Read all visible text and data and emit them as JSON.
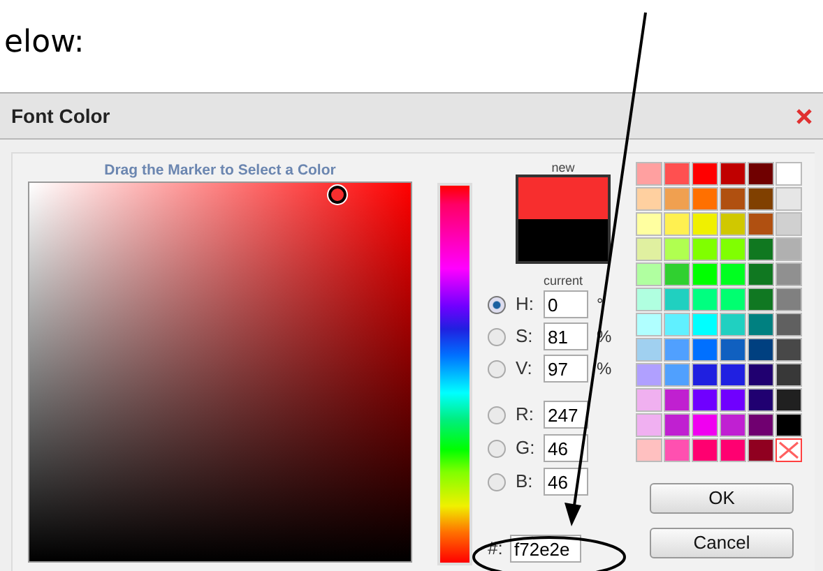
{
  "document_text": "elow:",
  "dialog": {
    "title": "Font Color",
    "heading": "Drag the Marker to Select a Color",
    "preview": {
      "new_label": "new",
      "current_label": "current"
    },
    "hsv_fields": [
      {
        "label": "H:",
        "value": "0",
        "unit": "°",
        "selected": true
      },
      {
        "label": "S:",
        "value": "81",
        "unit": "%",
        "selected": false
      },
      {
        "label": "V:",
        "value": "97",
        "unit": "%",
        "selected": false
      }
    ],
    "rgb_fields": [
      {
        "label": "R:",
        "value": "247",
        "selected": false
      },
      {
        "label": "G:",
        "value": "46",
        "selected": false
      },
      {
        "label": "B:",
        "value": "46",
        "selected": false
      }
    ],
    "hex_field": {
      "label": "#:",
      "value": "f72e2e"
    },
    "swatches": [
      {
        "kind": "color",
        "color": "#ffa0a0"
      },
      {
        "kind": "color",
        "color": "#ff5050"
      },
      {
        "kind": "color",
        "color": "#ff0000"
      },
      {
        "kind": "color",
        "color": "#c00000"
      },
      {
        "kind": "color",
        "color": "#700000"
      },
      {
        "kind": "color",
        "color": "#ffffff"
      },
      {
        "kind": "color",
        "color": "#ffd0a0"
      },
      {
        "kind": "color",
        "color": "#f0a050"
      },
      {
        "kind": "color",
        "color": "#ff7000"
      },
      {
        "kind": "color",
        "color": "#b05010"
      },
      {
        "kind": "color",
        "color": "#804000"
      },
      {
        "kind": "color",
        "color": "#e6e6e6"
      },
      {
        "kind": "color",
        "color": "#ffffa0"
      },
      {
        "kind": "color",
        "color": "#fff050"
      },
      {
        "kind": "color",
        "color": "#f0f000"
      },
      {
        "kind": "color",
        "color": "#d0c800"
      },
      {
        "kind": "color",
        "color": "#b05011"
      },
      {
        "kind": "color",
        "color": "#d0d0d0"
      },
      {
        "kind": "color",
        "color": "#e0f0a0"
      },
      {
        "kind": "color",
        "color": "#b0ff50"
      },
      {
        "kind": "color",
        "color": "#80ff00"
      },
      {
        "kind": "color",
        "color": "#80ff01"
      },
      {
        "kind": "color",
        "color": "#107820"
      },
      {
        "kind": "color",
        "color": "#b0b0b0"
      },
      {
        "kind": "color",
        "color": "#b0ffa0"
      },
      {
        "kind": "color",
        "color": "#30d030"
      },
      {
        "kind": "color",
        "color": "#00ff00"
      },
      {
        "kind": "color",
        "color": "#00ff20"
      },
      {
        "kind": "color",
        "color": "#107821"
      },
      {
        "kind": "color",
        "color": "#909090"
      },
      {
        "kind": "color",
        "color": "#b0ffe0"
      },
      {
        "kind": "color",
        "color": "#20d0c0"
      },
      {
        "kind": "color",
        "color": "#00ff80"
      },
      {
        "kind": "color",
        "color": "#00ff70"
      },
      {
        "kind": "color",
        "color": "#107822"
      },
      {
        "kind": "color",
        "color": "#808080"
      },
      {
        "kind": "color",
        "color": "#b0ffff"
      },
      {
        "kind": "color",
        "color": "#60f0ff"
      },
      {
        "kind": "color",
        "color": "#00ffff"
      },
      {
        "kind": "color",
        "color": "#20d0c1"
      },
      {
        "kind": "color",
        "color": "#008080"
      },
      {
        "kind": "color",
        "color": "#606060"
      },
      {
        "kind": "color",
        "color": "#a0d0f0"
      },
      {
        "kind": "color",
        "color": "#50a0ff"
      },
      {
        "kind": "color",
        "color": "#0070ff"
      },
      {
        "kind": "color",
        "color": "#1060c0"
      },
      {
        "kind": "color",
        "color": "#004080"
      },
      {
        "kind": "color",
        "color": "#484848"
      },
      {
        "kind": "color",
        "color": "#b0a0ff"
      },
      {
        "kind": "color",
        "color": "#50a0fe"
      },
      {
        "kind": "color",
        "color": "#2020e0"
      },
      {
        "kind": "color",
        "color": "#2020e1"
      },
      {
        "kind": "color",
        "color": "#200070"
      },
      {
        "kind": "color",
        "color": "#383838"
      },
      {
        "kind": "color",
        "color": "#f0b0f0"
      },
      {
        "kind": "color",
        "color": "#c020d0"
      },
      {
        "kind": "color",
        "color": "#7000ff"
      },
      {
        "kind": "color",
        "color": "#7000fe"
      },
      {
        "kind": "color",
        "color": "#200071"
      },
      {
        "kind": "color",
        "color": "#202020"
      },
      {
        "kind": "color",
        "color": "#f0b0f1"
      },
      {
        "kind": "color",
        "color": "#c020d1"
      },
      {
        "kind": "color",
        "color": "#f000f0"
      },
      {
        "kind": "color",
        "color": "#c020d2"
      },
      {
        "kind": "color",
        "color": "#700070"
      },
      {
        "kind": "color",
        "color": "#000000"
      },
      {
        "kind": "color",
        "color": "#ffc0c0"
      },
      {
        "kind": "color",
        "color": "#ff50b0"
      },
      {
        "kind": "color",
        "color": "#ff0070"
      },
      {
        "kind": "color",
        "color": "#ff0071"
      },
      {
        "kind": "color",
        "color": "#900020"
      },
      {
        "kind": "none"
      }
    ],
    "buttons": [
      "OK",
      "Cancel"
    ]
  }
}
